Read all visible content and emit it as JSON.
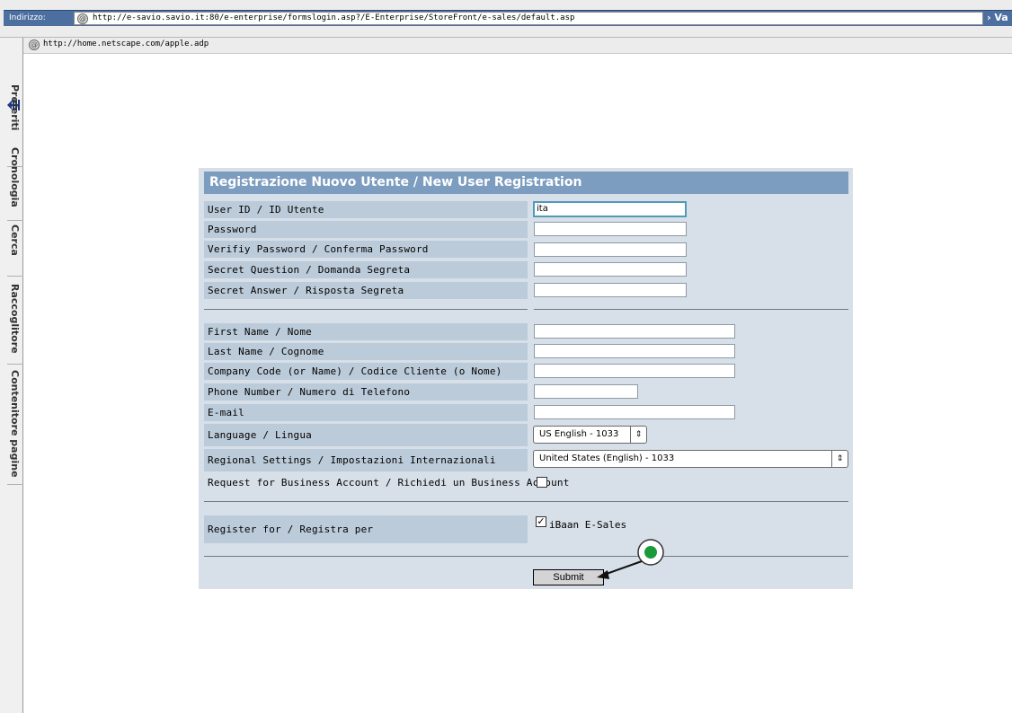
{
  "browser": {
    "address_label": "Indirizzo:",
    "address_url": "http://e-savio.savio.it:80/e-enterprise/formslogin.asp?/E-Enterprise/StoreFront/e-sales/default.asp",
    "go_label": "Va",
    "favorite_url": "http://home.netscape.com/apple.adp",
    "sidebar_tabs": [
      "Preferiti",
      "Cronologia",
      "Cerca",
      "Raccoglitore",
      "Contenitore pagine"
    ]
  },
  "form": {
    "title": "Registrazione Nuovo Utente / New User Registration",
    "fields": [
      {
        "label": "User ID / ID Utente",
        "value": "ita"
      },
      {
        "label": "Password",
        "value": ""
      },
      {
        "label": "Verifiy Password / Conferma Password",
        "value": ""
      },
      {
        "label": "Secret Question / Domanda Segreta",
        "value": ""
      },
      {
        "label": "Secret Answer / Risposta Segreta",
        "value": ""
      },
      {
        "label": "First Name / Nome",
        "value": ""
      },
      {
        "label": "Last Name / Cognome",
        "value": ""
      },
      {
        "label": "Company Code (or Name) / Codice Cliente (o Nome)",
        "value": ""
      },
      {
        "label": "Phone Number / Numero di Telefono",
        "value": ""
      },
      {
        "label": "E-mail",
        "value": ""
      }
    ],
    "language": {
      "label": "Language / Lingua",
      "selected": "US English - 1033"
    },
    "regional": {
      "label": "Regional Settings / Impostazioni Internazionali",
      "selected": "United States (English) - 1033"
    },
    "business_account": {
      "label": "Request for Business Account / Richiedi un Business Account",
      "checked": false
    },
    "register_for": {
      "label": "Register for / Registra per",
      "option_label": "iBaan E-Sales",
      "checked": true
    },
    "submit_label": "Submit"
  },
  "icons": {
    "at_icon": "at-sign-icon",
    "select_arrow": "up-down-arrows-icon",
    "check_mark": "checkmark-icon",
    "click_marker": "click-indicator-icon"
  },
  "colors": {
    "panel_bg": "#d7dfe8",
    "header_bg": "#7c9cc0",
    "label_bg": "#bccbd9",
    "address_strip": "#4c6fa0",
    "click_marker": "#1a9a3a"
  }
}
